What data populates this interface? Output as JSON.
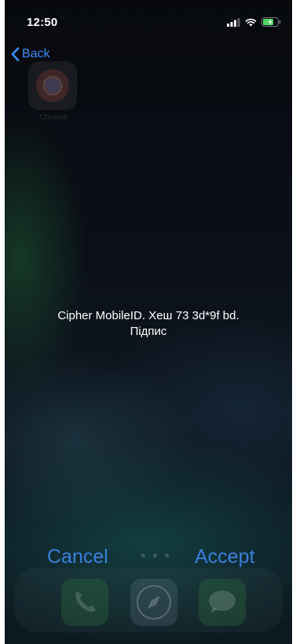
{
  "status_bar": {
    "time": "12:50"
  },
  "navigation": {
    "back_label": "Back"
  },
  "home_screen": {
    "app_label": "Chrome"
  },
  "alert": {
    "message_line1": "Cipher MobileID. Хеш 73 3d*9f bd.",
    "message_line2": "Підпис",
    "cancel_label": "Cancel",
    "accept_label": "Accept"
  },
  "dock": {
    "icons": [
      "phone-icon",
      "safari-icon",
      "messages-icon"
    ]
  },
  "colors": {
    "accent": "#3a7fde",
    "background": "#0b0f16",
    "text": "#ffffff"
  }
}
